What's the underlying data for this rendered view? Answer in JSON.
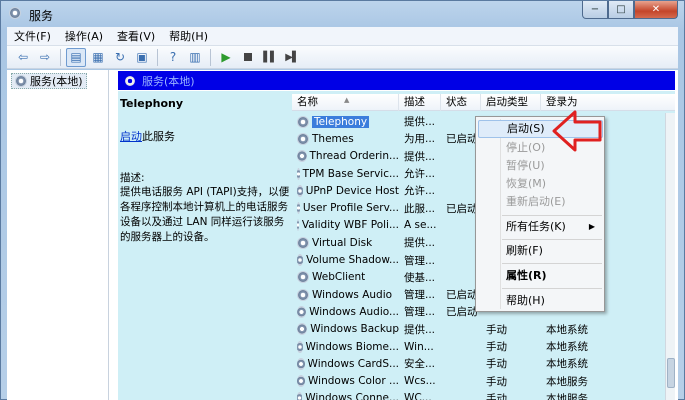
{
  "window": {
    "title": "服务",
    "close_label": "✕",
    "min_label": "−",
    "max_label": "□"
  },
  "menu": [
    "文件(F)",
    "操作(A)",
    "查看(V)",
    "帮助(H)"
  ],
  "tree": {
    "item": "服务(本地)"
  },
  "banner": {
    "title": "服务(本地)"
  },
  "detail": {
    "service_name": "Telephony",
    "start_link": "启动",
    "start_suffix": "此服务",
    "desc_label": "描述:",
    "desc_text": "提供电话服务 API (TAPI)支持，以便各程序控制本地计算机上的电话服务设备以及通过 LAN 同样运行该服务的服务器上的设备。"
  },
  "columns": [
    "名称",
    "描述",
    "状态",
    "启动类型",
    "登录为"
  ],
  "rows": [
    {
      "name": "Telephony",
      "desc": "提供...",
      "status": "",
      "startup": "",
      "logon": "",
      "selected": true
    },
    {
      "name": "Themes",
      "desc": "为用...",
      "status": "已启动",
      "startup": "",
      "logon": ""
    },
    {
      "name": "Thread Orderin...",
      "desc": "提供...",
      "status": "",
      "startup": "",
      "logon": ""
    },
    {
      "name": "TPM Base Servic...",
      "desc": "允许...",
      "status": "",
      "startup": "",
      "logon": ""
    },
    {
      "name": "UPnP Device Host",
      "desc": "允许...",
      "status": "",
      "startup": "",
      "logon": ""
    },
    {
      "name": "User Profile Serv...",
      "desc": "此服...",
      "status": "已启动",
      "startup": "",
      "logon": ""
    },
    {
      "name": "Validity WBF Poli...",
      "desc": "A se...",
      "status": "",
      "startup": "",
      "logon": ""
    },
    {
      "name": "Virtual Disk",
      "desc": "提供...",
      "status": "",
      "startup": "",
      "logon": ""
    },
    {
      "name": "Volume Shadow...",
      "desc": "管理...",
      "status": "",
      "startup": "",
      "logon": ""
    },
    {
      "name": "WebClient",
      "desc": "使基...",
      "status": "",
      "startup": "",
      "logon": ""
    },
    {
      "name": "Windows Audio",
      "desc": "管理...",
      "status": "已启动",
      "startup": "",
      "logon": ""
    },
    {
      "name": "Windows Audio...",
      "desc": "管理...",
      "status": "已启动",
      "startup": "",
      "logon": ""
    },
    {
      "name": "Windows Backup",
      "desc": "提供...",
      "status": "",
      "startup": "手动",
      "logon": "本地系统"
    },
    {
      "name": "Windows Biome...",
      "desc": "Win...",
      "status": "",
      "startup": "手动",
      "logon": "本地系统"
    },
    {
      "name": "Windows CardS...",
      "desc": "安全...",
      "status": "",
      "startup": "手动",
      "logon": "本地系统"
    },
    {
      "name": "Windows Color ...",
      "desc": "Wcs...",
      "status": "",
      "startup": "手动",
      "logon": "本地服务"
    },
    {
      "name": "Windows Conne...",
      "desc": "WC...",
      "status": "",
      "startup": "手动",
      "logon": "本地服务"
    }
  ],
  "context_menu": {
    "start": "启动(S)",
    "stop": "停止(O)",
    "pause": "暂停(U)",
    "resume": "恢复(M)",
    "restart": "重新启动(E)",
    "all_tasks": "所有任务(K)",
    "refresh": "刷新(F)",
    "properties": "属性(R)",
    "help": "帮助(H)"
  },
  "colors": {
    "banner": "#0000e6",
    "list_bg": "#cfeff6",
    "annotation_arrow": "#e02020"
  }
}
